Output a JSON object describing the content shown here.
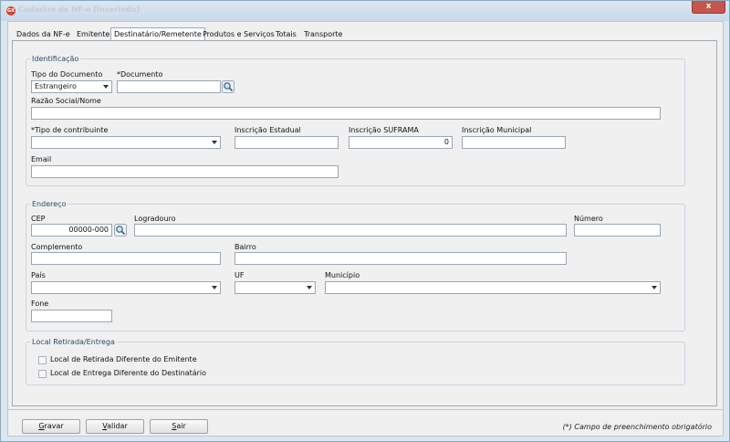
{
  "window": {
    "title": "Cadastro de NF-e [Inserindo]",
    "app_badge": "GX",
    "close_glyph": "x"
  },
  "tabs": [
    {
      "label": "Dados da NF-e"
    },
    {
      "label": "Emitente"
    },
    {
      "label": "Destinatário/Remetente",
      "active": true
    },
    {
      "label": "Produtos e Serviços"
    },
    {
      "label": "Totais"
    },
    {
      "label": "Transporte"
    }
  ],
  "identificacao": {
    "title": "Identificação",
    "tipo_documento_label": "Tipo do Documento",
    "tipo_documento_value": "Estrangeiro",
    "documento_label": "*Documento",
    "documento_value": "",
    "razao_social_label": "Razão Social/Nome",
    "razao_social_value": "",
    "tipo_contribuinte_label": "*Tipo de contribuinte",
    "tipo_contribuinte_value": "",
    "inscricao_estadual_label": "Inscrição Estadual",
    "inscricao_estadual_value": "",
    "inscricao_suframa_label": "Inscrição SUFRAMA",
    "inscricao_suframa_value": "0",
    "inscricao_municipal_label": "Inscrição Municipal",
    "inscricao_municipal_value": "",
    "email_label": "Email",
    "email_value": ""
  },
  "endereco": {
    "title": "Endereço",
    "cep_label": "CEP",
    "cep_value": "00000-000",
    "logradouro_label": "Logradouro",
    "logradouro_value": "",
    "numero_label": "Número",
    "numero_value": "",
    "complemento_label": "Complemento",
    "complemento_value": "",
    "bairro_label": "Bairro",
    "bairro_value": "",
    "pais_label": "País",
    "pais_value": "",
    "uf_label": "UF",
    "uf_value": "",
    "municipio_label": "Município",
    "municipio_value": "",
    "fone_label": "Fone",
    "fone_value": ""
  },
  "local": {
    "title": "Local Retirada/Entrega",
    "retirada_label": "Local de Retirada Diferente do Emitente",
    "retirada_checked": false,
    "entrega_label": "Local de Entrega Diferente do Destinatário",
    "entrega_checked": false
  },
  "buttons": {
    "gravar_first": "G",
    "gravar_rest": "ravar",
    "validar_first": "V",
    "validar_rest": "alidar",
    "sair_first": "S",
    "sair_rest": "air"
  },
  "footer_note": "(*) Campo de preenchimento obrigatório",
  "icons": {
    "lookup": "magnifier-icon",
    "dropdown": "chevron-down-icon"
  }
}
